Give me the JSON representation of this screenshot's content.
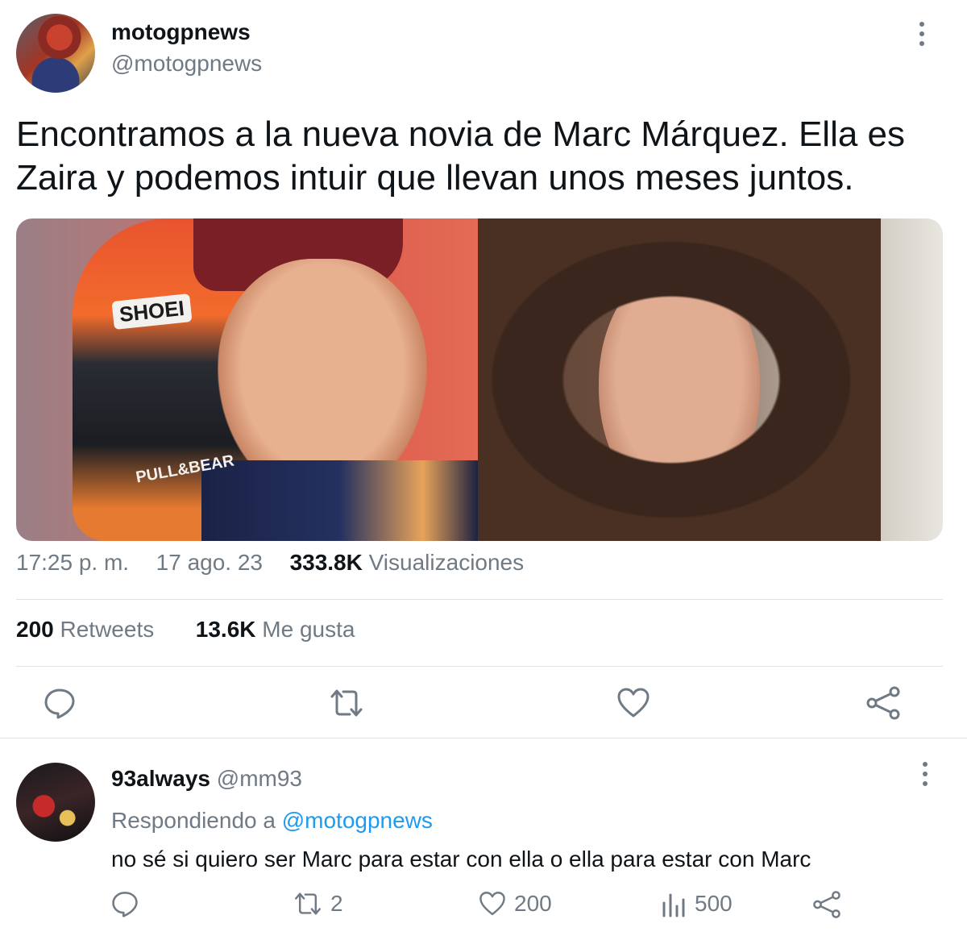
{
  "tweet": {
    "display_name": "motogpnews",
    "handle": "@motogpnews",
    "text": "Encontramos a la nueva novia de Marc Márquez. Ella es Zaira y podemos intuir que llevan unos meses juntos.",
    "time": "17:25 p. m.",
    "date": "17 ago. 23",
    "views_count": "333.8K",
    "views_label": "Visualizaciones",
    "retweets_count": "200",
    "retweets_label": "Retweets",
    "likes_count": "13.6K",
    "likes_label": "Me gusta",
    "media": {
      "helmet_brand": "SHOEI",
      "helmet_sponsor": "PULL&BEAR"
    }
  },
  "reply": {
    "display_name": "93always",
    "handle": "@mm93",
    "replying_prefix": "Respondiendo a",
    "replying_to": "@motogpnews",
    "text": "no sé si quiero ser Marc para estar con ella o ella para estar con Marc",
    "retweets": "2",
    "likes": "200",
    "views": "500"
  },
  "icons": {
    "menu": "more-vertical-icon",
    "reply": "comment-icon",
    "retweet": "retweet-icon",
    "like": "heart-icon",
    "share": "share-icon",
    "views": "analytics-icon"
  },
  "colors": {
    "text": "#0f1419",
    "secondary": "#6f7a85",
    "link": "#1d9bf0",
    "divider": "#dfe3e7"
  }
}
